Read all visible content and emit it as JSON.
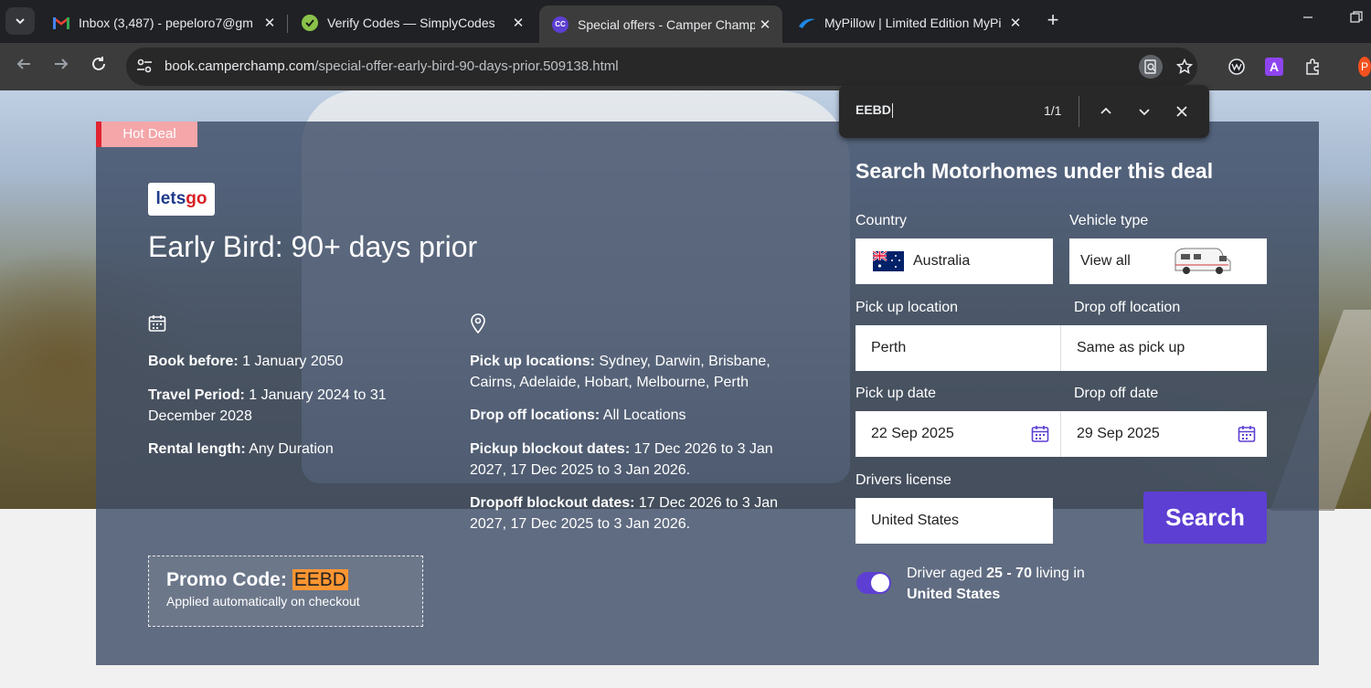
{
  "browser": {
    "tabs": [
      {
        "title": "Inbox (3,487) - pepeloro7@gm",
        "favicon": "gmail-icon",
        "active": false
      },
      {
        "title": "Verify Codes — SimplyCodes",
        "favicon": "simplycodes-icon",
        "active": false
      },
      {
        "title": "Special offers - Camper Champ",
        "favicon": "camperchamp-icon",
        "favicon_text": "CC",
        "active": true
      },
      {
        "title": "MyPillow | Limited Edition MyPi",
        "favicon": "mypillow-icon",
        "active": false
      }
    ],
    "url_host": "book.camperchamp.com",
    "url_path": "/special-offer-early-bird-90-days-prior.509138.html",
    "extension_a_label": "A",
    "profile_initial": "P"
  },
  "find_bar": {
    "query": "EEBD",
    "count": "1/1"
  },
  "deal": {
    "badge": "Hot Deal",
    "logo_part1": "lets",
    "logo_part2": "go",
    "title": "Early Bird: 90+ days prior",
    "book_before_label": "Book before:",
    "book_before_value": "1 January 2050",
    "travel_period_label": "Travel Period:",
    "travel_period_value": "1 January 2024 to 31 December 2028",
    "rental_length_label": "Rental length:",
    "rental_length_value": "Any Duration",
    "pickup_locations_label": "Pick up locations:",
    "pickup_locations_value": "Sydney, Darwin, Brisbane, Cairns, Adelaide, Hobart, Melbourne, Perth",
    "dropoff_locations_label": "Drop off locations:",
    "dropoff_locations_value": "All Locations",
    "pickup_blockout_label": "Pickup blockout dates:",
    "pickup_blockout_value": "17 Dec 2026 to 3 Jan 2027, 17 Dec 2025 to 3 Jan 2026.",
    "dropoff_blockout_label": "Dropoff blockout dates:",
    "dropoff_blockout_value": "17 Dec 2026 to 3 Jan 2027, 17 Dec 2025 to 3 Jan 2026.",
    "promo_label": "Promo Code:",
    "promo_code": "EEBD",
    "promo_note": "Applied automatically on checkout"
  },
  "search_form": {
    "title": "Search Motorhomes under this deal",
    "country_label": "Country",
    "country_value": "Australia",
    "vehicle_type_label": "Vehicle type",
    "vehicle_type_value": "View all",
    "pickup_location_label": "Pick up location",
    "pickup_location_value": "Perth",
    "dropoff_location_label": "Drop off location",
    "dropoff_location_value": "Same as pick up",
    "pickup_date_label": "Pick up date",
    "pickup_date_value": "22 Sep 2025",
    "dropoff_date_label": "Drop off date",
    "dropoff_date_value": "29 Sep 2025",
    "drivers_license_label": "Drivers license",
    "drivers_license_value": "United States",
    "search_button": "Search",
    "driver_text_1": "Driver aged ",
    "driver_age": "25 - 70",
    "driver_text_2": " living in",
    "driver_country": "United States",
    "driver_toggle_on": true
  },
  "colors": {
    "accent": "#5d3fd3",
    "hot_deal_red": "#e02432",
    "find_highlight": "#ff9632"
  }
}
